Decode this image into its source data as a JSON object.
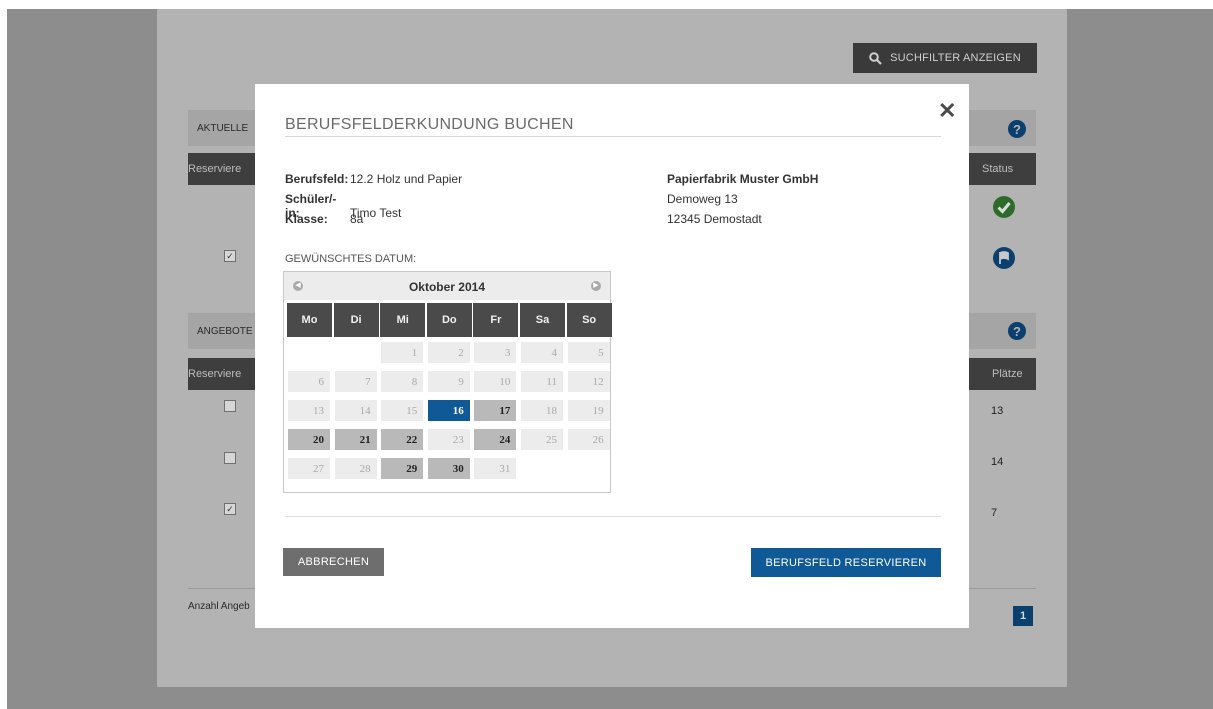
{
  "background": {
    "filter_button": {
      "label": "SUCHFILTER ANZEIGEN",
      "icon": "search-icon"
    },
    "section_current": {
      "label": "AKTUELLE",
      "help_icon": "question-icon"
    },
    "current_table": {
      "col_reserve": "Reserviere",
      "col_status": "Status",
      "rows": [
        {
          "checked": false,
          "status_icon": "check-circle-icon"
        },
        {
          "checked": true,
          "status_icon": "flag-circle-icon"
        }
      ]
    },
    "section_offers": {
      "label": "ANGEBOTE",
      "help_icon": "question-icon"
    },
    "offers_table": {
      "col_reserve": "Reserviere",
      "col_plaetze": "Plätze",
      "rows": [
        {
          "checked": false,
          "plaetze": "13"
        },
        {
          "checked": false,
          "plaetze": "14"
        },
        {
          "checked": true,
          "plaetze": "7"
        }
      ]
    },
    "footer_count": "Anzahl Angeb",
    "pagination": {
      "current": "1"
    }
  },
  "modal": {
    "title": "BERUFSFELDERKUNDUNG BUCHEN",
    "close_label": "✕",
    "info": [
      {
        "key": "Berufsfeld:",
        "value": "12.2  Holz und Papier"
      },
      {
        "key": "Schüler/-in:",
        "value": "Timo Test"
      },
      {
        "key": "Klasse:",
        "value": "8a"
      }
    ],
    "company": {
      "name": "Papierfabrik Muster GmbH",
      "street": "Demoweg 13",
      "city": "12345 Demostadt"
    },
    "date_label": "GEWÜNSCHTES DATUM:",
    "calendar": {
      "month": "Oktober 2014",
      "weekdays": [
        "Mo",
        "Di",
        "Mi",
        "Do",
        "Fr",
        "Sa",
        "So"
      ],
      "start_weekday_index": 2,
      "days_in_month": 31,
      "available_days": [
        16,
        17,
        20,
        21,
        22,
        24,
        29,
        30
      ],
      "selected_day": 16
    },
    "cancel_label": "ABBRECHEN",
    "reserve_label": "BERUFSFELD RESERVIEREN"
  },
  "colors": {
    "accent": "#0f5a96",
    "dark_button": "#3a3a3a",
    "cancel_button": "#6e6e6e",
    "status_ok": "#2e6b2a"
  }
}
